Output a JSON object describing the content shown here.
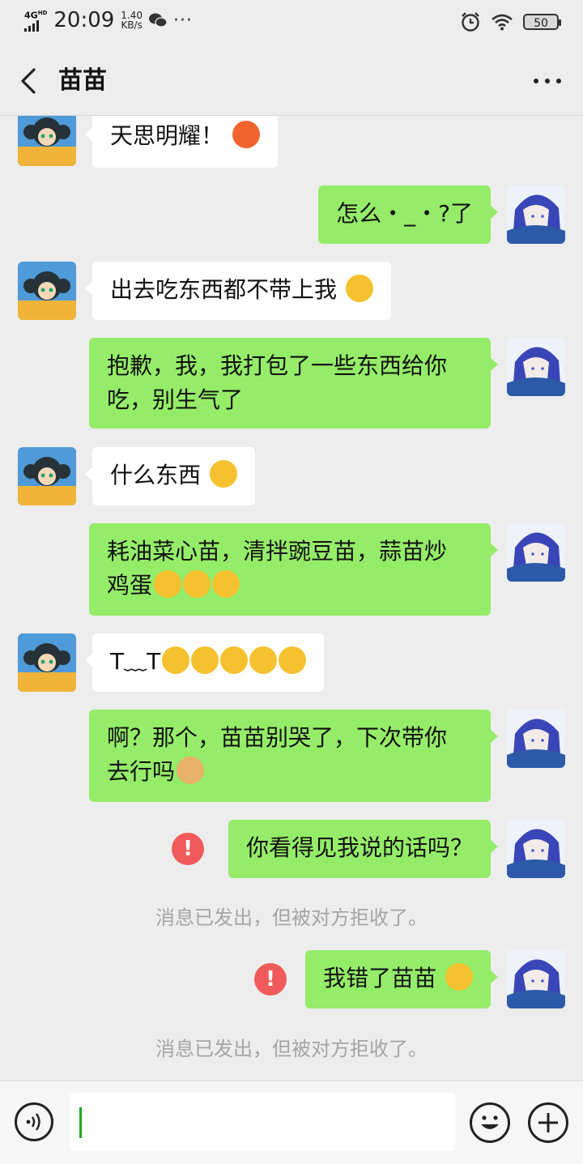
{
  "status_bar": {
    "network": "4G",
    "network_sub": "HD",
    "time": "20:09",
    "speed_value": "1.40",
    "speed_unit": "KB/s",
    "more": "···",
    "battery": "50"
  },
  "nav": {
    "title": "苗苗",
    "more": "···"
  },
  "messages": [
    {
      "side": "in",
      "text": "天思明耀！"
    },
    {
      "side": "out",
      "text": "怎么・_・?了"
    },
    {
      "side": "in",
      "text": "出去吃东西都不带上我"
    },
    {
      "side": "out",
      "line1": "抱歉，我，我打包了一些东西给你",
      "line2": "吃，别生气了"
    },
    {
      "side": "in",
      "text": "什么东西"
    },
    {
      "side": "out",
      "line1": "耗油菜心苗，清拌豌豆苗，蒜苗炒",
      "line2": "鸡蛋"
    },
    {
      "side": "in",
      "text": "T﹏T"
    },
    {
      "side": "out",
      "line1": "啊？那个，苗苗别哭了，下次带你",
      "line2": "去行吗"
    },
    {
      "side": "out",
      "text": "你看得见我说的话吗？",
      "failed": true
    },
    {
      "side": "out",
      "text": "我错了苗苗",
      "failed": true
    }
  ],
  "system": {
    "rejected_1": "消息已发出，但被对方拒收了。",
    "rejected_2": "消息已发出，但被对方拒收了。"
  },
  "error_mark": "!",
  "input": {
    "value": ""
  },
  "colors": {
    "background": "#ededed",
    "outgoing_bubble": "#95ec69",
    "incoming_bubble": "#ffffff",
    "error": "#f15a5a",
    "system_text": "#a5a5a5"
  },
  "icons": [
    "back-arrow-icon",
    "more-icon",
    "voice-icon",
    "emoji-icon",
    "plus-icon"
  ]
}
